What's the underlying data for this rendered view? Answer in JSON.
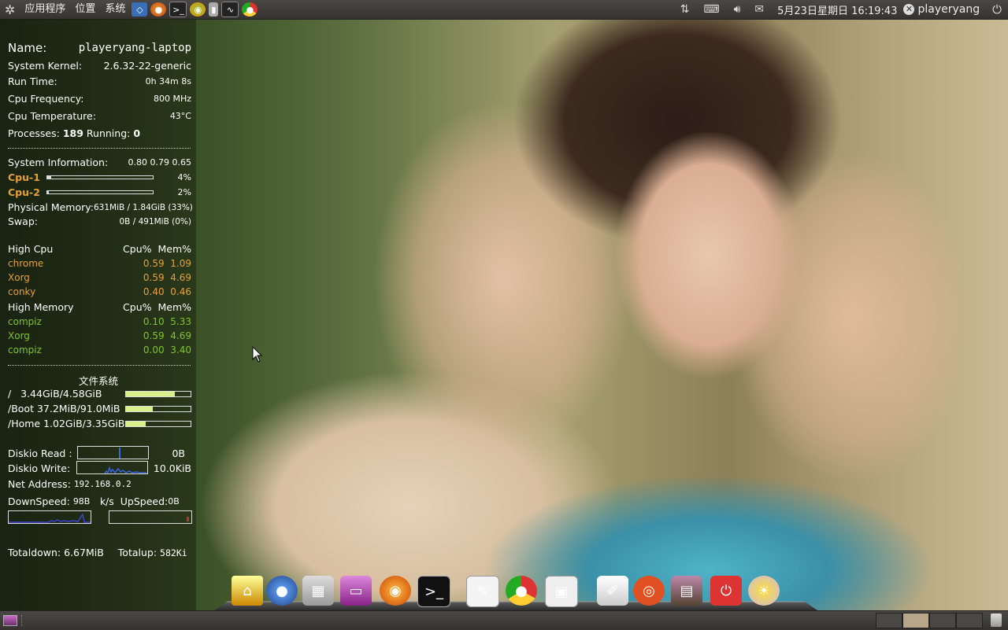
{
  "top_panel": {
    "menus": [
      "应用程序",
      "位置",
      "系统"
    ],
    "launchers": [
      "virtualbox-icon",
      "firefox-icon",
      "terminal-icon",
      "game-icon",
      "usb-icon",
      "system-monitor-icon",
      "chrome-icon"
    ],
    "clock": "5月23日星期日 16:19:43",
    "username": "playeryang"
  },
  "conky": {
    "name_label": "Name:",
    "name_value": "playeryang-laptop",
    "kernel_label": "System Kernel:",
    "kernel_value": "2.6.32-22-generic",
    "runtime_label": "Run Time:",
    "runtime_value": "0h 34m 8s",
    "cpufreq_label": "Cpu Frequency:",
    "cpufreq_value": "800 MHz",
    "cputemp_label": "Cpu Temperature:",
    "cputemp_value": "43°C",
    "processes_label": "Processes:",
    "processes_value": "189",
    "running_label": "Running:",
    "running_value": "0",
    "sysinfo_label": "System Information:",
    "loadavg": "0.80 0.79 0.65",
    "cpu1_label": "Cpu-1",
    "cpu1_value": "4%",
    "cpu1_fill": 4,
    "cpu2_label": "Cpu-2",
    "cpu2_value": "2%",
    "cpu2_fill": 2,
    "mem_label": "Physical Memory:",
    "mem_value": "631MiB / 1.84GiB (33%)",
    "swap_label": "Swap:",
    "swap_value": "0B  / 491MiB (0%)",
    "highcpu_label": "High Cpu",
    "cpu_col": "Cpu%",
    "mem_col": "Mem%",
    "highcpu": [
      {
        "name": "chrome",
        "cpu": "0.59",
        "mem": "1.09"
      },
      {
        "name": "Xorg",
        "cpu": "0.59",
        "mem": "4.69"
      },
      {
        "name": "conky",
        "cpu": "0.40",
        "mem": "0.46"
      }
    ],
    "highmem_label": "High Memory",
    "highmem": [
      {
        "name": "compiz",
        "cpu": "0.10",
        "mem": "5.33"
      },
      {
        "name": "Xorg",
        "cpu": "0.59",
        "mem": "4.69"
      },
      {
        "name": "compiz",
        "cpu": "0.00",
        "mem": "3.40"
      }
    ],
    "fs_title": "文件系统",
    "fs": [
      {
        "label": "/   3.44GiB/4.58GiB",
        "fill": 75
      },
      {
        "label": "/Boot 37.2MiB/91.0MiB",
        "fill": 41
      },
      {
        "label": "/Home 1.02GiB/3.35GiB",
        "fill": 30
      }
    ],
    "diskread_label": "Diskio Read  :",
    "diskread_value": "0B",
    "diskwrite_label": "Diskio Write:",
    "diskwrite_value": "10.0KiB",
    "netaddr_label": "Net Address:",
    "netaddr_value": "192.168.0.2",
    "downspeed_label": "DownSpeed:",
    "downspeed_value": "98B",
    "speed_unit": "k/s",
    "upspeed_label": "UpSpeed:",
    "upspeed_value": "0B",
    "totaldown_label": "Totaldown:",
    "totaldown_value": "6.67MiB",
    "totalup_label": "Totalup:",
    "totalup_value": "582Ki"
  },
  "dock_icons": [
    "broom-icon",
    "people-icon",
    "calculator-icon",
    "monitor-icon",
    "firefox-icon",
    "terminal-icon",
    "notepad-icon",
    "chrome-icon",
    "screenshot-icon",
    "text-editor-icon",
    "ubuntu-icon",
    "photo-viewer-icon",
    "power-icon",
    "weather-icon"
  ],
  "colors": {
    "accent": "#e8a030",
    "green": "#7ec820",
    "panel": "#3c3b37"
  }
}
